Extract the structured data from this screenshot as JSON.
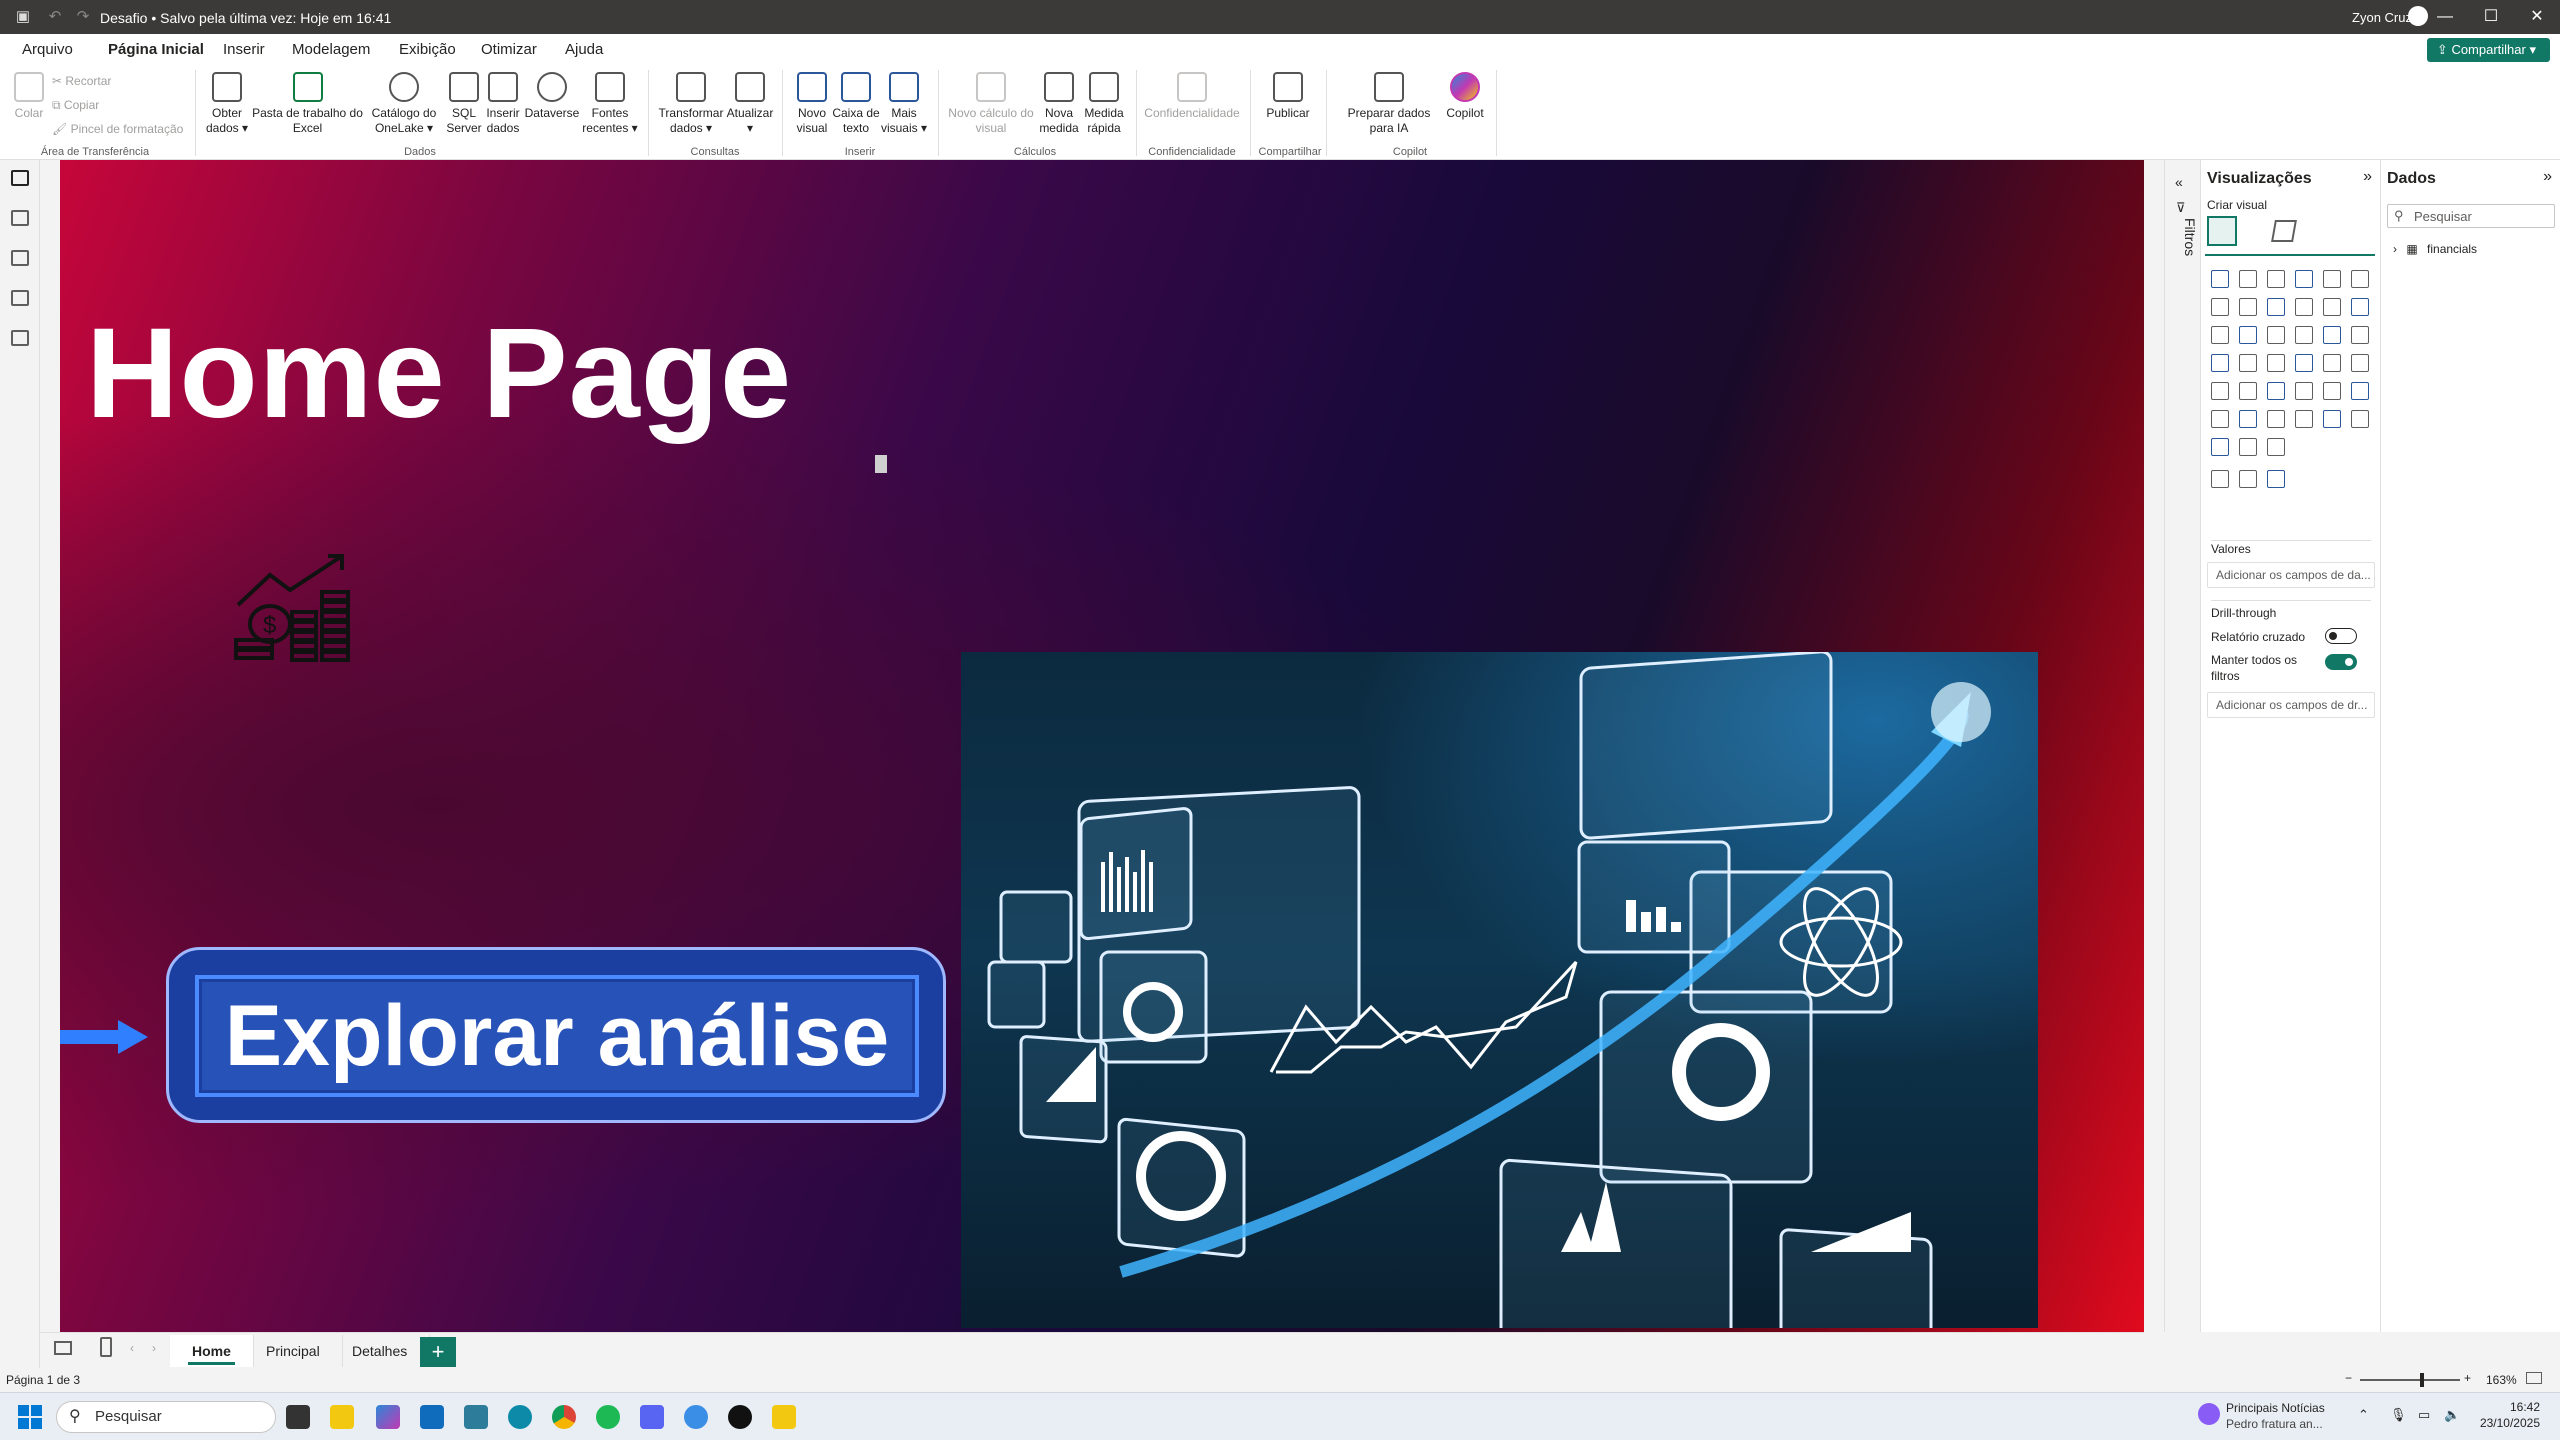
{
  "window": {
    "title": "Desafio • Salvo pela última vez: Hoje em 16:41",
    "user": "Zyon Cruz"
  },
  "menu": {
    "tabs": [
      "Arquivo",
      "Página Inicial",
      "Inserir",
      "Modelagem",
      "Exibição",
      "Otimizar",
      "Ajuda"
    ],
    "active_tab": "Página Inicial",
    "share_label": "Compartilhar"
  },
  "ribbon": {
    "clipboard": {
      "paste": "Colar",
      "cut": "Recortar",
      "copy": "Copiar",
      "format_painter": "Pincel de formatação",
      "group": "Área de Transferência"
    },
    "data": {
      "get_data": "Obter dados",
      "excel": "Pasta de trabalho do Excel",
      "onelake": "Catálogo do OneLake",
      "sql": "SQL Server",
      "enter_data": "Inserir dados",
      "dataverse": "Dataverse",
      "recent": "Fontes recentes",
      "group": "Dados"
    },
    "queries": {
      "transform": "Transformar dados",
      "refresh": "Atualizar",
      "group": "Consultas"
    },
    "insert": {
      "new_visual": "Novo visual",
      "textbox": "Caixa de texto",
      "more_visuals": "Mais visuais",
      "group": "Inserir"
    },
    "calculations": {
      "visual_calc": "Novo cálculo do visual",
      "new_measure": "Nova medida",
      "quick_measure": "Medida rápida",
      "group": "Cálculos"
    },
    "sensitivity": {
      "label": "Confidencialidade",
      "group": "Confidencialidade"
    },
    "share": {
      "publish": "Publicar",
      "group": "Compartilhar"
    },
    "copilot": {
      "prep": "Preparar dados para IA",
      "copilot": "Copilot",
      "group": "Copilot"
    }
  },
  "canvas": {
    "title": "Home Page",
    "explore_button": "Explorar análise"
  },
  "page_tabs": [
    "Home",
    "Principal",
    "Detalhes"
  ],
  "active_page": "Home",
  "status": {
    "page": "Página 1 de 3",
    "zoom": "163%"
  },
  "filters": {
    "label": "Filtros"
  },
  "visualizations": {
    "title": "Visualizações",
    "build_visual": "Criar visual",
    "values_label": "Valores",
    "values_placeholder": "Adicionar os campos de da...",
    "drillthrough": "Drill-through",
    "cross_report": "Relatório cruzado",
    "cross_report_on": false,
    "keep_filters": "Manter todos os filtros",
    "keep_filters_on": true,
    "drill_placeholder": "Adicionar os campos de dr..."
  },
  "data_pane": {
    "title": "Dados",
    "search_placeholder": "Pesquisar",
    "tables": [
      "financials"
    ]
  },
  "taskbar": {
    "search_placeholder": "Pesquisar",
    "news_title": "Principais Notícias",
    "news_sub": "Pedro fratura an...",
    "time": "16:42",
    "date": "23/10/2025"
  },
  "colors": {
    "accent": "#117865",
    "button_blue": "#2752b8"
  }
}
